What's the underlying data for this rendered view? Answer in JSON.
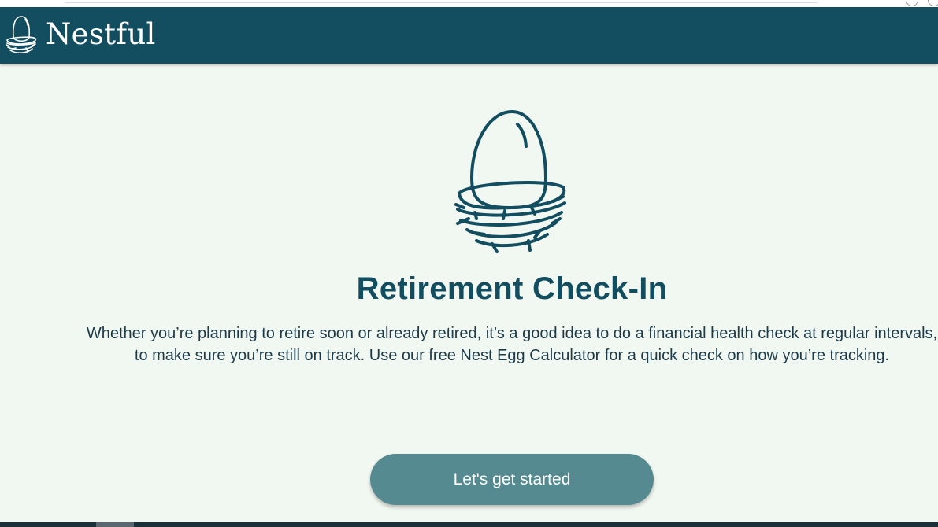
{
  "header": {
    "brand": "Nestful",
    "logo_icon": "nest-egg-icon",
    "background_color": "#134d60"
  },
  "hero": {
    "illustration_icon": "egg-in-nest-icon",
    "title": "Retirement Check-In",
    "intro": "Whether you’re planning to retire soon or already retired, it’s a good idea to do a financial health check at regular intervals, to make sure you’re still on track. Use our free Nest Egg Calculator for a quick check on how you’re tracking."
  },
  "cta": {
    "label": "Let's get started",
    "color": "#558a90"
  },
  "colors": {
    "page_background": "#f1f7f1",
    "accent": "#134d60"
  }
}
